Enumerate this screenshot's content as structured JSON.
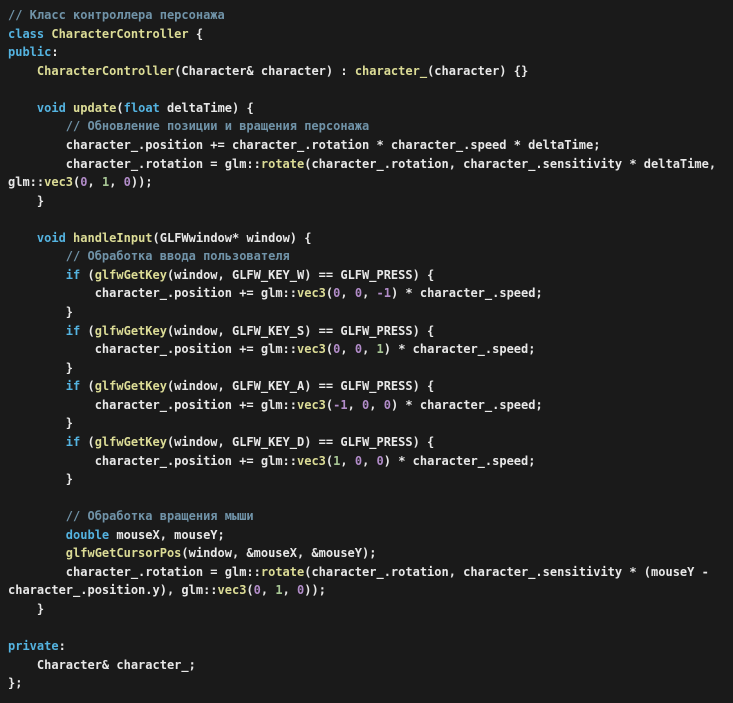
{
  "window": {
    "kind": "code-view",
    "background": "#1a1a1a"
  },
  "palette": {
    "background": "#1a1a1a",
    "text": "#e8e8e8",
    "keyword": "#54b3e0",
    "function": "#dcdc96",
    "comment": "#7093a8",
    "number_purple": "#b28cc9",
    "number_green": "#a8c795"
  },
  "code": {
    "language": "cpp",
    "lines": [
      [
        {
          "t": "// Класс контроллера персонажа",
          "c": "cm"
        }
      ],
      [
        {
          "t": "class",
          "c": "kw"
        },
        {
          "t": " ",
          "c": "txt"
        },
        {
          "t": "CharacterController",
          "c": "fn"
        },
        {
          "t": " {",
          "c": "txt"
        }
      ],
      [
        {
          "t": "public",
          "c": "kw"
        },
        {
          "t": ":",
          "c": "txt"
        }
      ],
      [
        {
          "t": "    ",
          "c": "txt"
        },
        {
          "t": "CharacterController",
          "c": "fn"
        },
        {
          "t": "(Character& character) : ",
          "c": "txt"
        },
        {
          "t": "character_",
          "c": "fn"
        },
        {
          "t": "(character) {}",
          "c": "txt"
        }
      ],
      [],
      [
        {
          "t": "    ",
          "c": "txt"
        },
        {
          "t": "void",
          "c": "kw"
        },
        {
          "t": " ",
          "c": "txt"
        },
        {
          "t": "update",
          "c": "fn"
        },
        {
          "t": "(",
          "c": "txt"
        },
        {
          "t": "float",
          "c": "kw"
        },
        {
          "t": " deltaTime) {",
          "c": "txt"
        }
      ],
      [
        {
          "t": "        ",
          "c": "txt"
        },
        {
          "t": "// Обновление позиции и вращения персонажа",
          "c": "cm"
        }
      ],
      [
        {
          "t": "        character_.position += character_.rotation * character_.speed * deltaTime;",
          "c": "txt"
        }
      ],
      [
        {
          "t": "        character_.rotation = glm::",
          "c": "txt"
        },
        {
          "t": "rotate",
          "c": "fn"
        },
        {
          "t": "(character_.rotation, character_.sensitivity * deltaTime, glm::",
          "c": "txt"
        },
        {
          "t": "vec3",
          "c": "fn"
        },
        {
          "t": "(",
          "c": "txt"
        },
        {
          "t": "0",
          "c": "np"
        },
        {
          "t": ", ",
          "c": "txt"
        },
        {
          "t": "1",
          "c": "ng"
        },
        {
          "t": ", ",
          "c": "txt"
        },
        {
          "t": "0",
          "c": "np"
        },
        {
          "t": "));",
          "c": "txt"
        }
      ],
      [
        {
          "t": "    }",
          "c": "txt"
        }
      ],
      [],
      [
        {
          "t": "    ",
          "c": "txt"
        },
        {
          "t": "void",
          "c": "kw"
        },
        {
          "t": " ",
          "c": "txt"
        },
        {
          "t": "handleInput",
          "c": "fn"
        },
        {
          "t": "(GLFWwindow* window) {",
          "c": "txt"
        }
      ],
      [
        {
          "t": "        ",
          "c": "txt"
        },
        {
          "t": "// Обработка ввода пользователя",
          "c": "cm"
        }
      ],
      [
        {
          "t": "        ",
          "c": "txt"
        },
        {
          "t": "if",
          "c": "kw"
        },
        {
          "t": " (",
          "c": "txt"
        },
        {
          "t": "glfwGetKey",
          "c": "fn"
        },
        {
          "t": "(window, GLFW_KEY_W) == GLFW_PRESS) {",
          "c": "txt"
        }
      ],
      [
        {
          "t": "            character_.position += glm::",
          "c": "txt"
        },
        {
          "t": "vec3",
          "c": "fn"
        },
        {
          "t": "(",
          "c": "txt"
        },
        {
          "t": "0",
          "c": "np"
        },
        {
          "t": ", ",
          "c": "txt"
        },
        {
          "t": "0",
          "c": "np"
        },
        {
          "t": ", ",
          "c": "txt"
        },
        {
          "t": "-1",
          "c": "np"
        },
        {
          "t": ") * character_.speed;",
          "c": "txt"
        }
      ],
      [
        {
          "t": "        }",
          "c": "txt"
        }
      ],
      [
        {
          "t": "        ",
          "c": "txt"
        },
        {
          "t": "if",
          "c": "kw"
        },
        {
          "t": " (",
          "c": "txt"
        },
        {
          "t": "glfwGetKey",
          "c": "fn"
        },
        {
          "t": "(window, GLFW_KEY_S) == GLFW_PRESS) {",
          "c": "txt"
        }
      ],
      [
        {
          "t": "            character_.position += glm::",
          "c": "txt"
        },
        {
          "t": "vec3",
          "c": "fn"
        },
        {
          "t": "(",
          "c": "txt"
        },
        {
          "t": "0",
          "c": "np"
        },
        {
          "t": ", ",
          "c": "txt"
        },
        {
          "t": "0",
          "c": "np"
        },
        {
          "t": ", ",
          "c": "txt"
        },
        {
          "t": "1",
          "c": "ng"
        },
        {
          "t": ") * character_.speed;",
          "c": "txt"
        }
      ],
      [
        {
          "t": "        }",
          "c": "txt"
        }
      ],
      [
        {
          "t": "        ",
          "c": "txt"
        },
        {
          "t": "if",
          "c": "kw"
        },
        {
          "t": " (",
          "c": "txt"
        },
        {
          "t": "glfwGetKey",
          "c": "fn"
        },
        {
          "t": "(window, GLFW_KEY_A) == GLFW_PRESS) {",
          "c": "txt"
        }
      ],
      [
        {
          "t": "            character_.position += glm::",
          "c": "txt"
        },
        {
          "t": "vec3",
          "c": "fn"
        },
        {
          "t": "(",
          "c": "txt"
        },
        {
          "t": "-1",
          "c": "np"
        },
        {
          "t": ", ",
          "c": "txt"
        },
        {
          "t": "0",
          "c": "np"
        },
        {
          "t": ", ",
          "c": "txt"
        },
        {
          "t": "0",
          "c": "np"
        },
        {
          "t": ") * character_.speed;",
          "c": "txt"
        }
      ],
      [
        {
          "t": "        }",
          "c": "txt"
        }
      ],
      [
        {
          "t": "        ",
          "c": "txt"
        },
        {
          "t": "if",
          "c": "kw"
        },
        {
          "t": " (",
          "c": "txt"
        },
        {
          "t": "glfwGetKey",
          "c": "fn"
        },
        {
          "t": "(window, GLFW_KEY_D) == GLFW_PRESS) {",
          "c": "txt"
        }
      ],
      [
        {
          "t": "            character_.position += glm::",
          "c": "txt"
        },
        {
          "t": "vec3",
          "c": "fn"
        },
        {
          "t": "(",
          "c": "txt"
        },
        {
          "t": "1",
          "c": "ng"
        },
        {
          "t": ", ",
          "c": "txt"
        },
        {
          "t": "0",
          "c": "np"
        },
        {
          "t": ", ",
          "c": "txt"
        },
        {
          "t": "0",
          "c": "np"
        },
        {
          "t": ") * character_.speed;",
          "c": "txt"
        }
      ],
      [
        {
          "t": "        }",
          "c": "txt"
        }
      ],
      [],
      [
        {
          "t": "        ",
          "c": "txt"
        },
        {
          "t": "// Обработка вращения мыши",
          "c": "cm"
        }
      ],
      [
        {
          "t": "        ",
          "c": "txt"
        },
        {
          "t": "double",
          "c": "kw"
        },
        {
          "t": " mouseX, mouseY;",
          "c": "txt"
        }
      ],
      [
        {
          "t": "        ",
          "c": "txt"
        },
        {
          "t": "glfwGetCursorPos",
          "c": "fn"
        },
        {
          "t": "(window, &mouseX, &mouseY);",
          "c": "txt"
        }
      ],
      [
        {
          "t": "        character_.rotation = glm::",
          "c": "txt"
        },
        {
          "t": "rotate",
          "c": "fn"
        },
        {
          "t": "(character_.rotation, character_.sensitivity * (mouseY - character_.position.y), glm::",
          "c": "txt"
        },
        {
          "t": "vec3",
          "c": "fn"
        },
        {
          "t": "(",
          "c": "txt"
        },
        {
          "t": "0",
          "c": "np"
        },
        {
          "t": ", ",
          "c": "txt"
        },
        {
          "t": "1",
          "c": "ng"
        },
        {
          "t": ", ",
          "c": "txt"
        },
        {
          "t": "0",
          "c": "np"
        },
        {
          "t": "));",
          "c": "txt"
        }
      ],
      [
        {
          "t": "    }",
          "c": "txt"
        }
      ],
      [],
      [
        {
          "t": "private",
          "c": "kw"
        },
        {
          "t": ":",
          "c": "txt"
        }
      ],
      [
        {
          "t": "    Character& character_;",
          "c": "txt"
        }
      ],
      [
        {
          "t": "};",
          "c": "txt"
        }
      ]
    ]
  }
}
